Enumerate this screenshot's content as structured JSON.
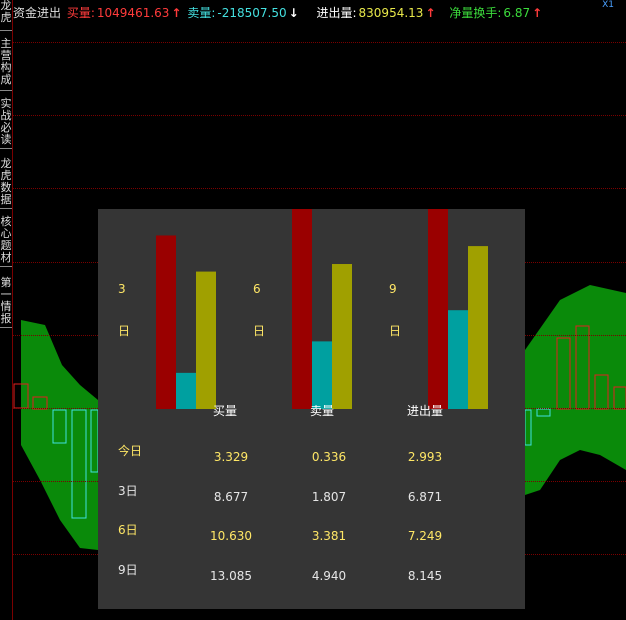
{
  "left_tabs": [
    "龙虎",
    "主营构成",
    "实战必读",
    "龙虎数据",
    "核心题材",
    "第一情报"
  ],
  "topbar": {
    "title": "资金进出",
    "buy_label": "买量:",
    "buy_value": "1049461.63",
    "sell_label": "卖量:",
    "sell_value": "-218507.50",
    "net_label": "进出量:",
    "net_value": "830954.13",
    "turnover_label": "净量换手:",
    "turnover_value": "6.87",
    "up_arrow": "↑",
    "down_arrow": "↓"
  },
  "corner_text": "X1",
  "colors": {
    "buy": "#9a0000",
    "sell": "#00a0a0",
    "net": "#a0a000",
    "area": "#0a8a0a",
    "popup_bg": "#353535"
  },
  "chart_data": {
    "type": "bar",
    "title": "",
    "groups": [
      {
        "day_number": "3",
        "day_unit": "日"
      },
      {
        "day_number": "6",
        "day_unit": "日"
      },
      {
        "day_number": "9",
        "day_unit": "日"
      }
    ],
    "bar_legend": [
      "买量",
      "卖量",
      "进出量"
    ],
    "bar_values": {
      "3日": {
        "买量": 8.677,
        "卖量": 1.807,
        "进出量": 6.871
      },
      "6日": {
        "买量": 10.63,
        "卖量": 3.381,
        "进出量": 7.249
      },
      "9日": {
        "买量": 13.085,
        "卖量": 4.94,
        "进出量": 8.145
      }
    },
    "table": {
      "headers": [
        "买量",
        "卖量",
        "进出量"
      ],
      "rows": [
        {
          "label": "今日",
          "values": [
            "3.329",
            "0.336",
            "2.993"
          ],
          "highlight": true
        },
        {
          "label": "3日",
          "values": [
            "8.677",
            "1.807",
            "6.871"
          ],
          "highlight": false
        },
        {
          "label": "6日",
          "values": [
            "10.630",
            "3.381",
            "7.249"
          ],
          "highlight": true
        },
        {
          "label": "9日",
          "values": [
            "13.085",
            "4.940",
            "8.145"
          ],
          "highlight": false
        }
      ]
    }
  }
}
